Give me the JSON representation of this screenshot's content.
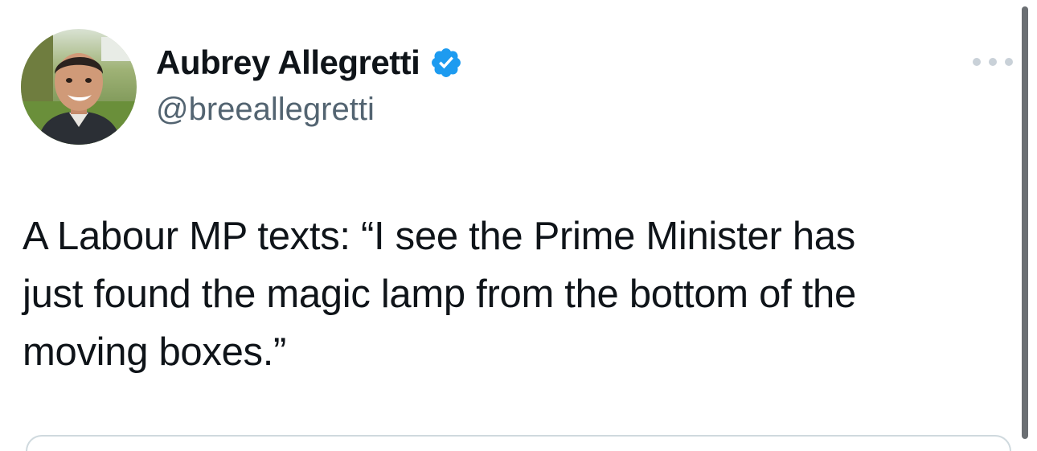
{
  "author": {
    "display_name": "Aubrey Allegretti",
    "handle": "@breeallegretti",
    "verified": true,
    "verified_icon": "verified-badge-icon"
  },
  "tweet": {
    "text": "A Labour MP texts: “I see the Prime Minister has\njust found the magic lamp from the bottom of the\nmoving boxes.”"
  },
  "icons": {
    "more": "more-options-icon"
  },
  "colors": {
    "text_primary": "#0f1419",
    "text_secondary": "#536471",
    "verified_blue": "#1d9bf0",
    "more_dots": "#c9d1d8",
    "scrollbar": "#6b6f73"
  }
}
